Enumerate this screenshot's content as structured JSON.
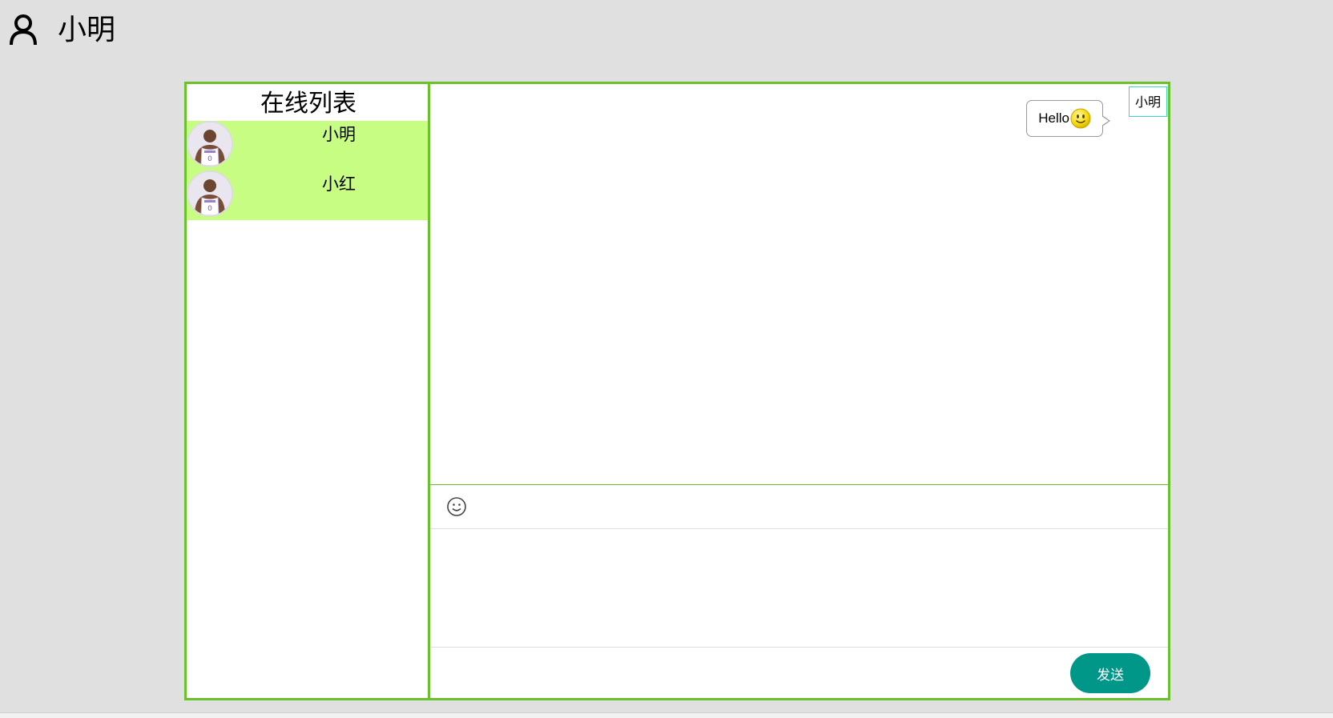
{
  "header": {
    "user_icon": "user-icon",
    "username": "小明"
  },
  "sidebar": {
    "title": "在线列表",
    "users": [
      {
        "name": "小明",
        "avatar": "player-avatar"
      },
      {
        "name": "小红",
        "avatar": "player-avatar"
      }
    ],
    "highlight_color": "#c7fd83"
  },
  "chat": {
    "messages": [
      {
        "sender": "小明",
        "text": "Hello",
        "emoji": "smiley-emoji"
      }
    ],
    "toolbar": {
      "emoji_button_icon": "smiley-icon"
    },
    "input": {
      "value": "",
      "placeholder": ""
    },
    "send_label": "发送"
  },
  "colors": {
    "frame_border": "#6ac12c",
    "send_button": "#009688",
    "background": "#e0e0e0",
    "sender_tag_border": "#3fd3c0"
  }
}
